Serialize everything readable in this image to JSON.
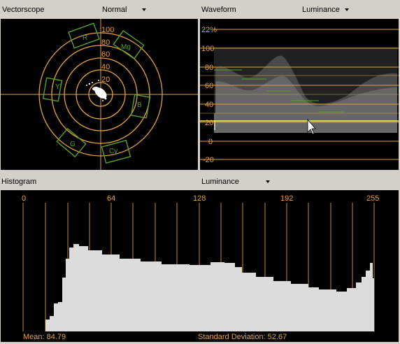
{
  "vectorscope": {
    "title": "Vectorscope",
    "mode": "Normal",
    "ring_labels": [
      "100",
      "80",
      "60",
      "40",
      "20"
    ],
    "targets": [
      "R",
      "Mg",
      "Yl",
      "B",
      "G",
      "Cy"
    ]
  },
  "waveform": {
    "title": "Waveform",
    "mode": "Luminance",
    "percent_readout": "22%",
    "scale_labels": [
      "100",
      "80",
      "60",
      "40",
      "20",
      "0",
      "-20"
    ]
  },
  "histogram": {
    "title": "Histogram",
    "mode": "Luminance",
    "axis_labels": [
      "0",
      "64",
      "128",
      "192",
      "255"
    ],
    "mean_text": "Mean: 84.79",
    "stddev_text": "Standard Deviation: 52.67"
  },
  "colors": {
    "scale_amber": "#e6a23c",
    "target_green": "#5aa02c",
    "panel_bg": "#000000",
    "chrome": "#d4d0c8"
  }
}
